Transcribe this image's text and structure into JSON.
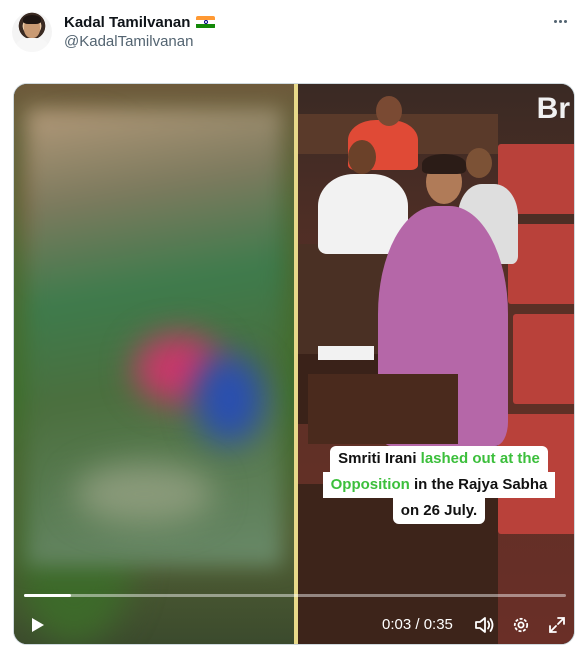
{
  "tweet": {
    "display_name": "Kadal Tamilvanan",
    "handle": "@KadalTamilvanan",
    "flag_icon": "india-flag-icon",
    "more_icon": "more-icon"
  },
  "video": {
    "logo_text": "Br",
    "caption": {
      "line1_a": "Smriti Irani ",
      "line1_b": "lashed out at the",
      "line2_a": "Opposition",
      "line2_b": " in the Rajya Sabha",
      "line3": "on 26 July.",
      "highlight_color": "#3cbf3c"
    },
    "player": {
      "time_display": "0:03 / 0:35",
      "progress_fraction": 0.086,
      "play_icon": "play-icon",
      "volume_icon": "volume-icon",
      "settings_icon": "gear-icon",
      "fullscreen_icon": "fullscreen-icon"
    }
  }
}
